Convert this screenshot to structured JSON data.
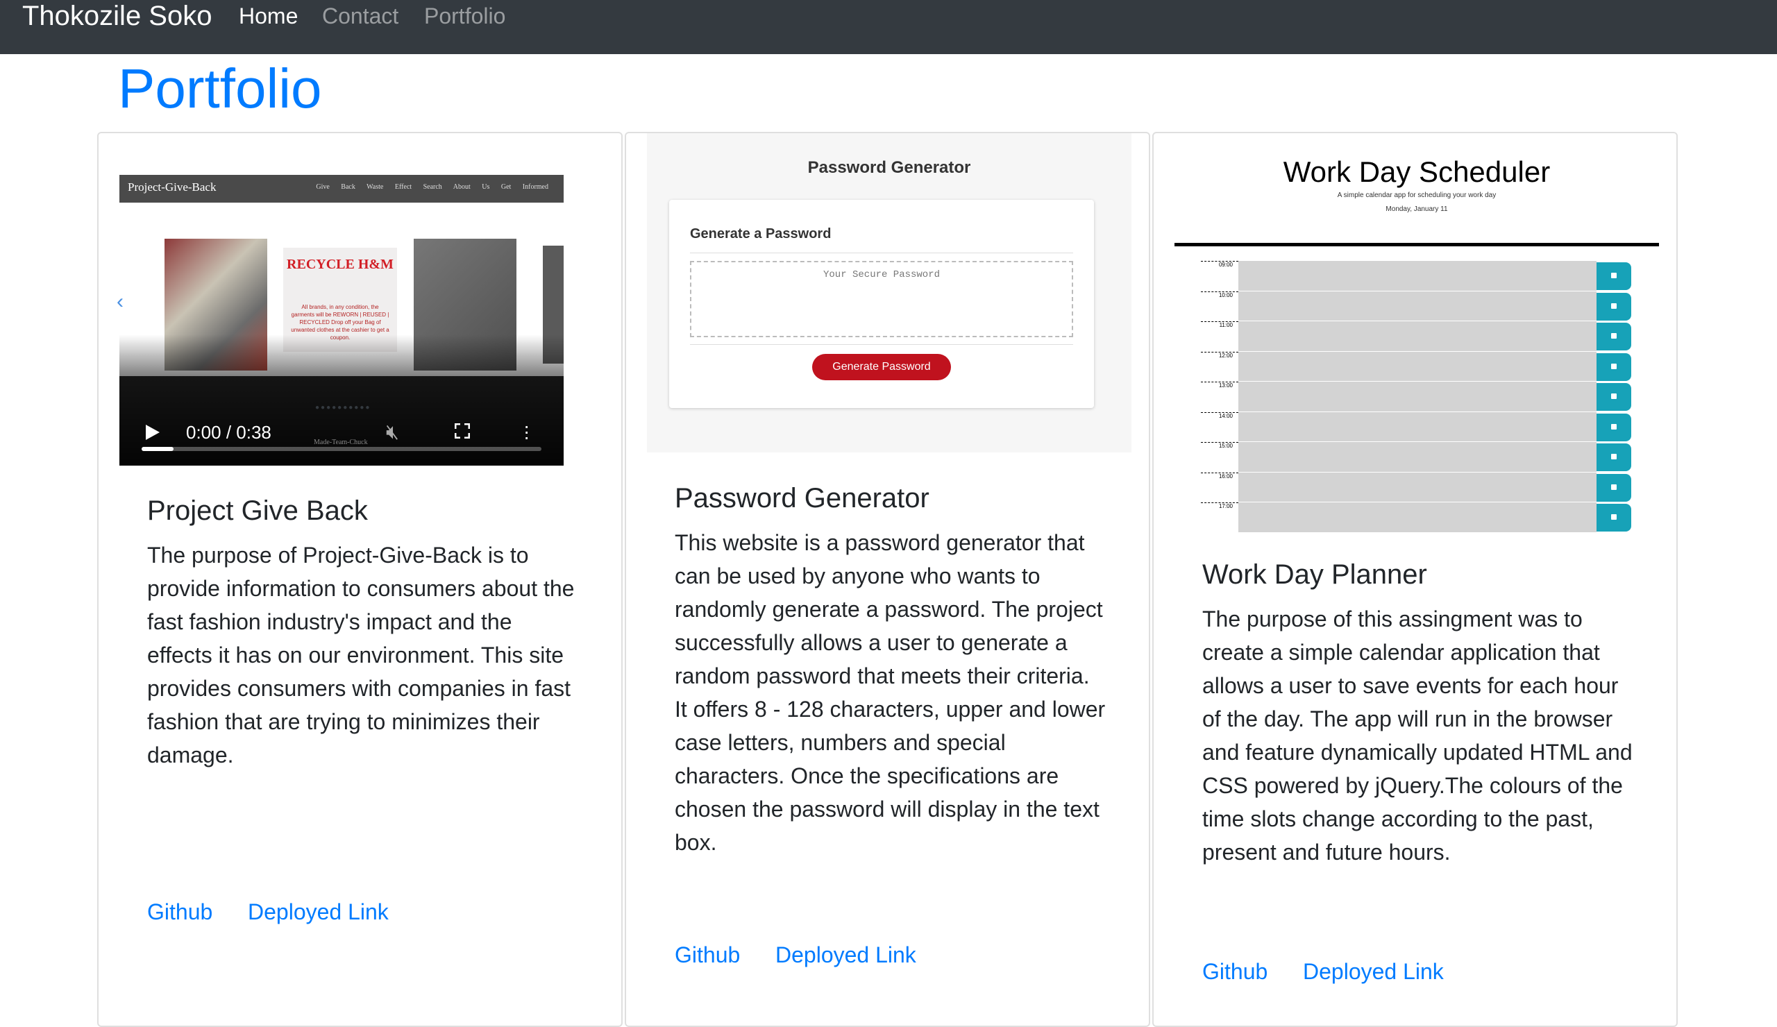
{
  "navbar": {
    "brand": "Thokozile Soko",
    "links": [
      {
        "label": "Home",
        "active": true
      },
      {
        "label": "Contact",
        "active": false
      },
      {
        "label": "Portfolio",
        "active": false
      }
    ]
  },
  "page_title": "Portfolio",
  "colors": {
    "navbar_bg": "#343a40",
    "link": "#007bff",
    "pw_button": "#c0121e",
    "save_button": "#17a2b8"
  },
  "cards": [
    {
      "title": "Project Give Back",
      "text": "The purpose of Project-Give-Back is to provide information to consumers about the fast fashion industry's impact and the effects it has on our environment. This site provides consumers with companies in fast fashion that are trying to minimizes their damage.",
      "github_label": "Github",
      "deployed_label": "Deployed Link",
      "video": {
        "site_title": "Project-Give-Back",
        "site_menu": "Give Back  Waste Effect  Search  About Us  Get Informed",
        "panel_heading": "RECYCLE H&M",
        "panel_text": "All brands, in any condition, the garments will be REWORN | REUSED | RECYCLED Drop off your Bag of unwanted clothes at the cashier to get a coupon.",
        "time": "0:00 / 0:38",
        "progress": 0.08,
        "watermark": "Made-Team-Chuck"
      }
    },
    {
      "title": "Password Generator",
      "text": "This website is a password generator that can be used by anyone who wants to randomly generate a password. The project successfully allows a user to generate a random password that meets their criteria. It offers 8 - 128 characters, upper and lower case letters, numbers and special characters. Once the specifications are chosen the password will display in the text box.",
      "github_label": "Github",
      "deployed_label": "Deployed Link",
      "preview": {
        "title": "Password Generator",
        "card_heading": "Generate a Password",
        "placeholder": "Your Secure Password",
        "button": "Generate Password"
      }
    },
    {
      "title": "Work Day Planner",
      "text": "The purpose of this assingment was to create a simple calendar application that allows a user to save events for each hour of the day. The app will run in the browser and feature dynamically updated HTML and CSS powered by jQuery.The colours of the time slots change according to the past, present and future hours.",
      "github_label": "Github",
      "deployed_label": "Deployed Link",
      "preview": {
        "title": "Work Day Scheduler",
        "subtitle": "A simple calendar app for scheduling your work day",
        "date": "Monday, January 11",
        "hours": [
          "09:00",
          "10:00",
          "11:00",
          "12:00",
          "13:00",
          "14:00",
          "15:00",
          "16:00",
          "17:00"
        ]
      }
    }
  ]
}
